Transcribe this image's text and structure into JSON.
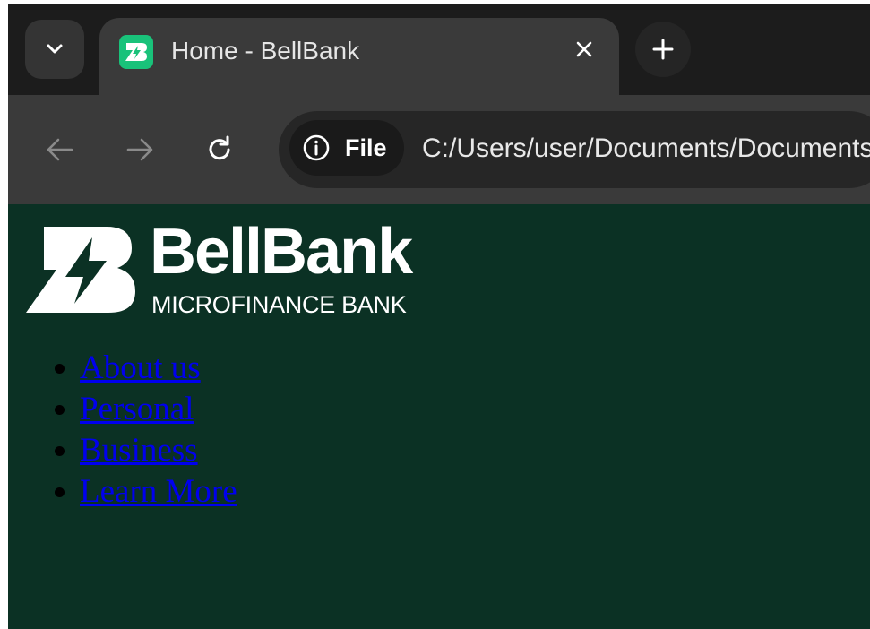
{
  "browser": {
    "tab": {
      "title": "Home - BellBank",
      "favicon": "bellbank-logo-icon"
    },
    "tab_controls": {
      "tab_search_icon": "chevron-down-icon",
      "close_icon": "close-icon",
      "new_tab_icon": "plus-icon"
    },
    "toolbar": {
      "back_icon": "arrow-left-icon",
      "forward_icon": "arrow-right-icon",
      "reload_icon": "reload-icon",
      "site_info": {
        "icon": "info-icon",
        "label": "File"
      },
      "url": "C:/Users/user/Documents/Documents"
    }
  },
  "page": {
    "logo": {
      "name": "BellBank",
      "subtitle": "MICROFINANCE BANK"
    },
    "nav": [
      {
        "label": "About us"
      },
      {
        "label": "Personal"
      },
      {
        "label": "Business"
      },
      {
        "label": "Learn More"
      }
    ]
  },
  "colors": {
    "page_background": "#0b3124",
    "tab_strip": "#1c1c1c",
    "toolbar": "#3a3a3a",
    "link": "#0000ee",
    "brand_green": "#19c27a"
  }
}
